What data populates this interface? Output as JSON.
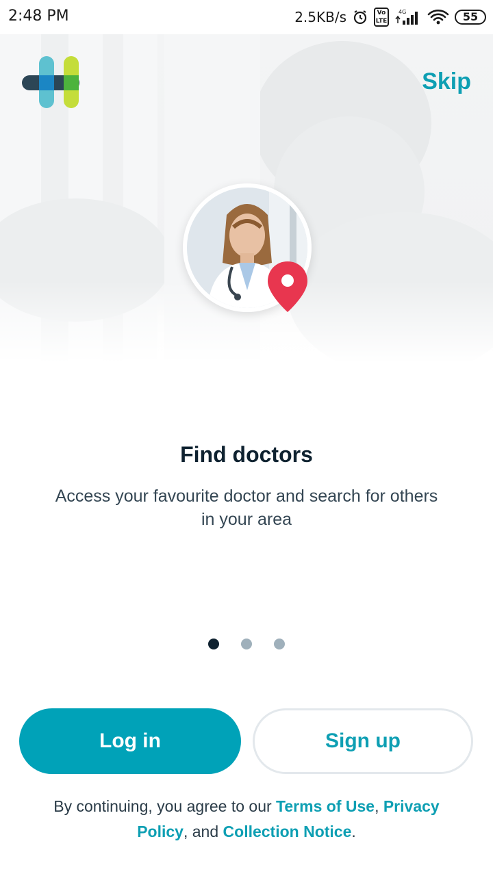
{
  "status_bar": {
    "time": "2:48 PM",
    "speed": "2.5KB/s",
    "volte": "Vo LTE",
    "network": "4G",
    "battery": "55"
  },
  "header": {
    "logo_icon": "healthengine-plus-logo",
    "skip_label": "Skip"
  },
  "hero": {
    "avatar_icon": "doctor-avatar",
    "pin_icon": "location-pin-icon",
    "pin_color": "#e8364f"
  },
  "onboarding": {
    "title": "Find doctors",
    "subtitle": "Access your favourite doctor and search for others in your area",
    "page_count": 3,
    "active_page": 1
  },
  "actions": {
    "login_label": "Log in",
    "signup_label": "Sign up"
  },
  "legal": {
    "prefix": "By continuing, you agree to our",
    "terms_link": "Terms of Use",
    "comma": ",",
    "privacy_link": "Privacy Policy",
    "middle": ", and",
    "collection_link": "Collection Notice",
    "suffix": "."
  },
  "colors": {
    "accent": "#00a2b8",
    "accent_text": "#0e9fb3",
    "title": "#0f2230",
    "dot_inactive": "#9fb0bb"
  }
}
